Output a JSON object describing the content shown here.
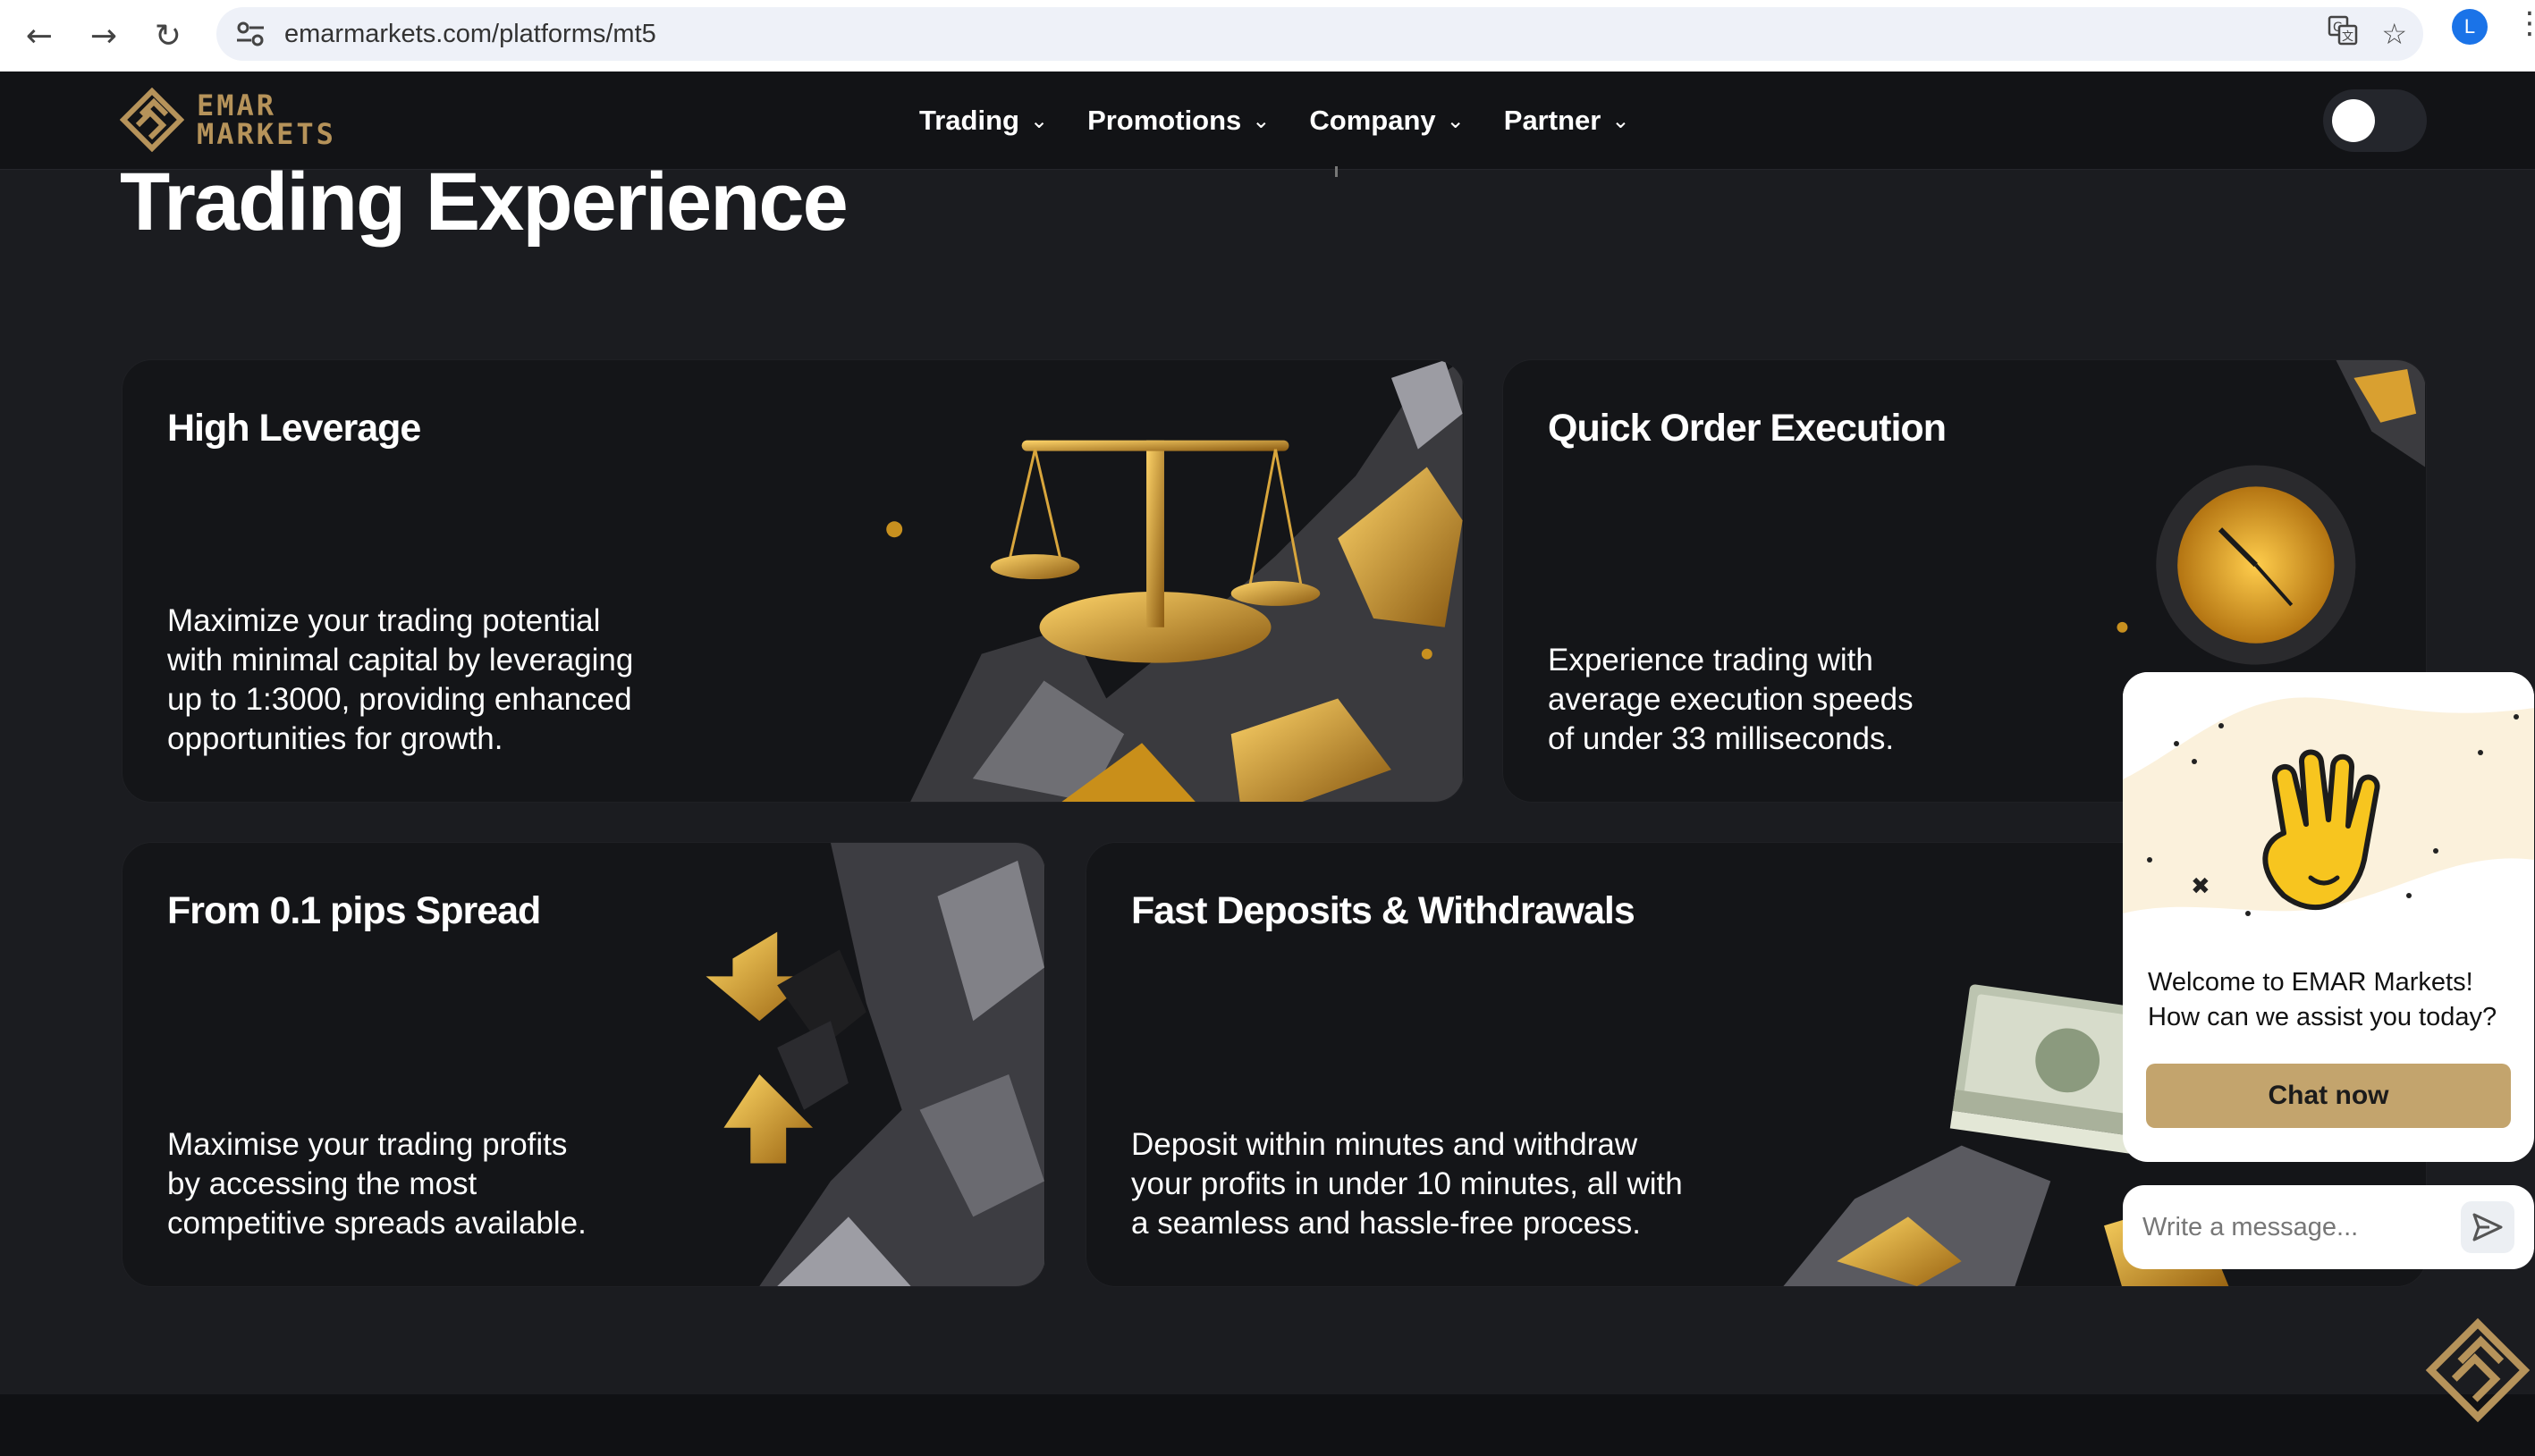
{
  "browser": {
    "url": "emarmarkets.com/platforms/mt5",
    "profile_initial": "L",
    "icons": [
      "back-arrow-icon",
      "forward-arrow-icon",
      "reload-icon",
      "site-settings-icon",
      "translate-icon",
      "star-icon",
      "kebab-menu-icon"
    ]
  },
  "header": {
    "logo_line1": "EMAR",
    "logo_line2": "MARKETS",
    "nav": [
      {
        "label": "Trading"
      },
      {
        "label": "Promotions"
      },
      {
        "label": "Company"
      },
      {
        "label": "Partner"
      }
    ],
    "theme_toggle": "dark"
  },
  "main": {
    "section_title": "Trading Experience",
    "cards": [
      {
        "title": "High Leverage",
        "desc_lines": [
          "Maximize your trading potential",
          "with minimal capital by leveraging",
          "up to 1:3000, providing enhanced",
          "opportunities for growth."
        ],
        "art_icon": "gold-scale-icon"
      },
      {
        "title": "Quick Order Execution",
        "desc_lines": [
          "Experience trading with",
          "average execution speeds",
          "of under 33 milliseconds."
        ],
        "art_icon": "gold-clock-icon"
      },
      {
        "title": "From 0.1 pips Spread",
        "desc_lines": [
          "Maximise your trading profits",
          "by accessing the most",
          "competitive spreads available."
        ],
        "art_icon": "gold-arrows-icon"
      },
      {
        "title": "Fast Deposits & Withdrawals",
        "desc_lines": [
          "Deposit within minutes and withdraw",
          "your profits in under 10 minutes, all with",
          "a seamless and hassle-free process."
        ],
        "art_icon": "cash-stack-icon"
      }
    ]
  },
  "chat": {
    "welcome_line1": "Welcome to EMAR Markets!",
    "welcome_line2": "How can we assist you today?",
    "button_label": "Chat now",
    "input_placeholder": "Write a message...",
    "hero_icon": "waving-hand-icon"
  },
  "colors": {
    "brand_gold": "#c3a46d",
    "logo_gold": "#b6935a",
    "page_bg": "#1b1c20",
    "card_bg": "#141518"
  }
}
